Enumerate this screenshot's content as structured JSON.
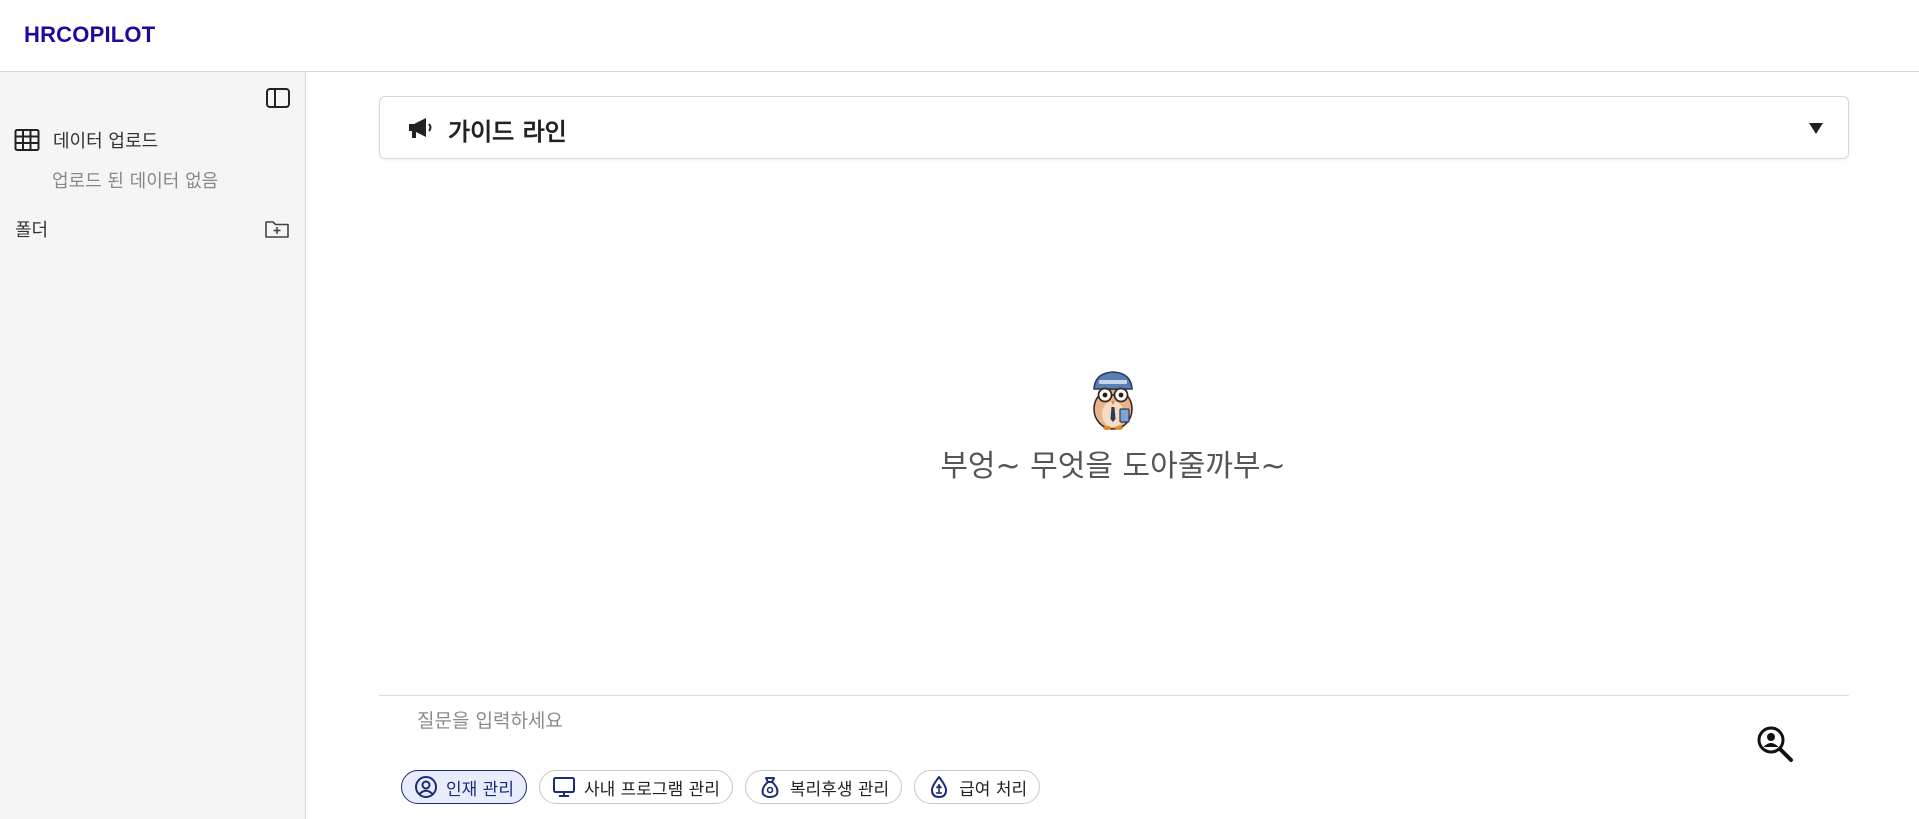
{
  "header": {
    "brand": "HRCOPILOT"
  },
  "sidebar": {
    "data_upload_label": "데이터 업로드",
    "data_empty_text": "업로드 된 데이터 없음",
    "folder_label": "폴더"
  },
  "guide": {
    "title": "가이드 라인"
  },
  "welcome": {
    "text": "부엉~ 무엇을 도아줄까부~"
  },
  "chat": {
    "placeholder": "질문을 입력하세요"
  },
  "chips": [
    {
      "label": "인재 관리",
      "icon": "person-circle-icon",
      "active": true
    },
    {
      "label": "사내 프로그램 관리",
      "icon": "monitor-icon",
      "active": false
    },
    {
      "label": "복리후생 관리",
      "icon": "money-bag-icon",
      "active": false
    },
    {
      "label": "급여 처리",
      "icon": "money-drop-icon",
      "active": false
    }
  ],
  "colors": {
    "brand": "#1c0aa0",
    "accent": "#1c2a7a"
  }
}
